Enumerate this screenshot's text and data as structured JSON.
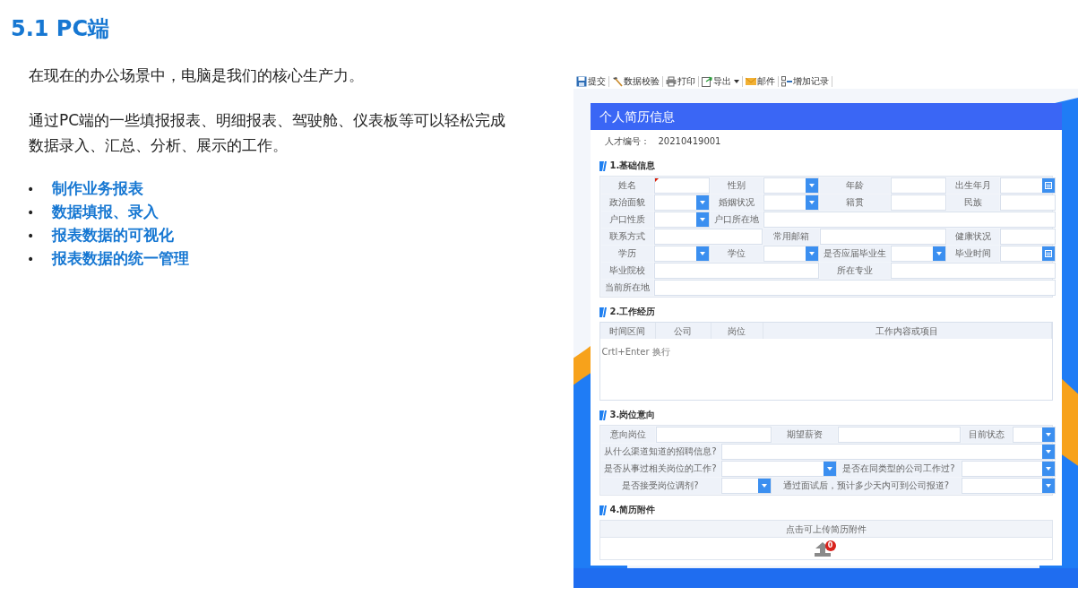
{
  "slide": {
    "title": "5.1 PC端",
    "paragraphs": [
      "在现在的办公场景中，电脑是我们的核心生产力。",
      "通过PC端的一些填报报表、明细报表、驾驶舱、仪表板等可以轻松完成数据录入、汇总、分析、展示的工作。"
    ],
    "bullets": [
      {
        "bullet": "•",
        "text": "制作业务报表"
      },
      {
        "bullet": "•",
        "text": "数据填报、录入"
      },
      {
        "bullet": "•",
        "text": "报表数据的可视化"
      },
      {
        "bullet": "•",
        "text": "报表数据的统一管理"
      }
    ]
  },
  "app": {
    "toolbar": [
      {
        "kind": "save",
        "label": "提交",
        "dropdown": false
      },
      {
        "kind": "check",
        "label": "数据校验",
        "dropdown": false
      },
      {
        "kind": "print",
        "label": "打印",
        "dropdown": false
      },
      {
        "kind": "export",
        "label": "导出",
        "dropdown": true
      },
      {
        "kind": "mail",
        "label": "邮件",
        "dropdown": false
      },
      {
        "kind": "add",
        "label": "增加记录",
        "dropdown": false
      }
    ],
    "form": {
      "title": "个人简历信息",
      "id_label": "人才编号：",
      "id_value": "20210419001",
      "sections": [
        {
          "kind": "grid",
          "title": "1.基础信息",
          "rows": [
            [
              {
                "kind": "label",
                "text": "姓名"
              },
              {
                "kind": "text",
                "required": true
              },
              {
                "kind": "label",
                "text": "性别"
              },
              {
                "kind": "select",
                "required": false
              },
              {
                "kind": "label",
                "text": "年龄"
              },
              {
                "kind": "text",
                "required": false
              },
              {
                "kind": "label",
                "text": "出生年月"
              },
              {
                "kind": "date",
                "required": false
              }
            ],
            [
              {
                "kind": "label",
                "text": "政治面貌"
              },
              {
                "kind": "select",
                "required": false
              },
              {
                "kind": "label",
                "text": "婚姻状况"
              },
              {
                "kind": "select",
                "required": false
              },
              {
                "kind": "label",
                "text": "籍贯"
              },
              {
                "kind": "text",
                "required": false
              },
              {
                "kind": "label",
                "text": "民族"
              },
              {
                "kind": "text",
                "required": false
              }
            ],
            [
              {
                "kind": "label",
                "text": "户口性质"
              },
              {
                "kind": "select",
                "required": false
              },
              {
                "kind": "label",
                "text": "户口所在地"
              },
              {
                "kind": "text",
                "required": false
              },
              {
                "kind": "merged"
              },
              {
                "kind": "merged"
              },
              {
                "kind": "merged"
              },
              {
                "kind": "merged"
              }
            ],
            [
              {
                "kind": "label",
                "text": "联系方式"
              },
              {
                "kind": "text",
                "required": false
              },
              {
                "kind": "merged"
              },
              {
                "kind": "label",
                "text": "常用邮箱"
              },
              {
                "kind": "text",
                "required": false
              },
              {
                "kind": "merged"
              },
              {
                "kind": "label",
                "text": "健康状况"
              },
              {
                "kind": "text",
                "required": false
              }
            ],
            [
              {
                "kind": "label",
                "text": "学历"
              },
              {
                "kind": "select",
                "required": false
              },
              {
                "kind": "label",
                "text": "学位"
              },
              {
                "kind": "select",
                "required": false
              },
              {
                "kind": "label",
                "text": "是否应届毕业生"
              },
              {
                "kind": "select",
                "required": false
              },
              {
                "kind": "label",
                "text": "毕业时间"
              },
              {
                "kind": "date",
                "required": false
              }
            ],
            [
              {
                "kind": "label",
                "text": "毕业院校"
              },
              {
                "kind": "text",
                "required": false
              },
              {
                "kind": "merged"
              },
              {
                "kind": "merged"
              },
              {
                "kind": "label",
                "text": "所在专业"
              },
              {
                "kind": "text",
                "required": false
              },
              {
                "kind": "merged"
              },
              {
                "kind": "merged"
              }
            ],
            [
              {
                "kind": "label",
                "text": "当前所在地"
              },
              {
                "kind": "text",
                "required": false
              },
              {
                "kind": "merged"
              },
              {
                "kind": "merged"
              },
              {
                "kind": "merged"
              },
              {
                "kind": "merged"
              },
              {
                "kind": "merged"
              },
              {
                "kind": "merged"
              }
            ]
          ]
        },
        {
          "kind": "table",
          "title": "2.工作经历",
          "columns": [
            "时间区间",
            "公司",
            "岗位",
            "工作内容或项目"
          ],
          "placeholder": "Crtl+Enter 换行"
        },
        {
          "kind": "grid",
          "title": "3.岗位意向",
          "rows": [
            [
              {
                "kind": "label",
                "text": "意向岗位"
              },
              {
                "kind": "text",
                "required": false
              },
              {
                "kind": "merged"
              },
              {
                "kind": "label",
                "text": "期望薪资"
              },
              {
                "kind": "text",
                "required": false
              },
              {
                "kind": "merged"
              },
              {
                "kind": "label",
                "text": "目前状态"
              },
              {
                "kind": "select",
                "required": false
              }
            ],
            [
              {
                "kind": "label",
                "text": "从什么渠道知道的招聘信息?"
              },
              {
                "kind": "merged"
              },
              {
                "kind": "select",
                "required": false
              },
              {
                "kind": "merged"
              },
              {
                "kind": "merged"
              },
              {
                "kind": "merged"
              },
              {
                "kind": "merged"
              },
              {
                "kind": "merged"
              }
            ],
            [
              {
                "kind": "label",
                "text": "是否从事过相关岗位的工作?"
              },
              {
                "kind": "merged"
              },
              {
                "kind": "select",
                "required": false
              },
              {
                "kind": "merged"
              },
              {
                "kind": "label",
                "text": "是否在同类型的公司工作过?"
              },
              {
                "kind": "merged"
              },
              {
                "kind": "select",
                "required": false
              },
              {
                "kind": "merged"
              }
            ],
            [
              {
                "kind": "label",
                "text": "是否接受岗位调剂?"
              },
              {
                "kind": "merged"
              },
              {
                "kind": "select",
                "required": false
              },
              {
                "kind": "label",
                "text": "通过面试后，预计多少天内可到公司报道?"
              },
              {
                "kind": "merged"
              },
              {
                "kind": "merged"
              },
              {
                "kind": "select",
                "required": false
              },
              {
                "kind": "merged"
              }
            ]
          ]
        },
        {
          "kind": "upload",
          "title": "4.简历附件",
          "prompt": "点击可上传简历附件",
          "badge": "0"
        }
      ]
    }
  }
}
